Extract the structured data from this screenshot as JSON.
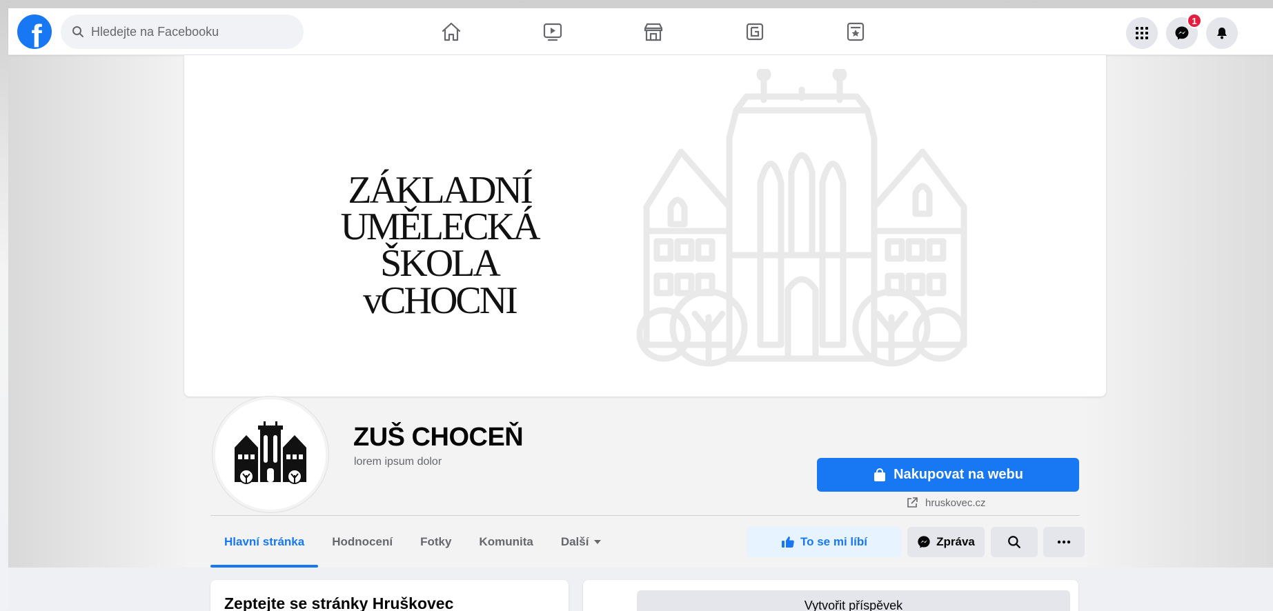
{
  "topbar": {
    "logo_letter": "f",
    "search_placeholder": "Hledejte na Facebooku",
    "nav_icons": [
      "home-icon",
      "watch-icon",
      "marketplace-icon",
      "gaming-icon",
      "news-icon"
    ],
    "right_icons": [
      "menu-grid-icon",
      "messenger-icon",
      "notifications-icon"
    ],
    "messenger_badge": "1"
  },
  "cover": {
    "line1": "ZÁKLADNÍ",
    "line2": "UMĚLECKÁ ŠKOLA",
    "line3": "vCHOCNI"
  },
  "profile": {
    "name": "ZUŠ CHOCEŇ",
    "subtitle": "lorem ipsum dolor",
    "shop_button": "Nakupovat na webu",
    "website": "hruskovec.cz"
  },
  "tabs": [
    {
      "label": "Hlavní stránka",
      "active": true
    },
    {
      "label": "Hodnocení",
      "active": false
    },
    {
      "label": "Fotky",
      "active": false
    },
    {
      "label": "Komunita",
      "active": false
    },
    {
      "label": "Další",
      "active": false
    }
  ],
  "actions": {
    "like": "To se mi líbí",
    "message": "Zpráva"
  },
  "cards": {
    "ask_title": "Zeptejte se stránky Hruškovec",
    "create_post": "Vytvořit příspěvek"
  },
  "colors": {
    "brand": "#1877f2",
    "badge": "#e41e3f"
  }
}
